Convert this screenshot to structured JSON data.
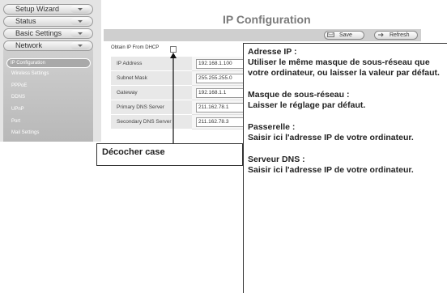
{
  "sidebar": {
    "menu": [
      "Setup Wizard",
      "Status",
      "Basic Settings",
      "Network"
    ],
    "submenu": [
      "IP Configuration",
      "Wireless Settings",
      "PPPoE",
      "DDNS",
      "UPnP",
      "Port",
      "Mail Settings"
    ]
  },
  "header": {
    "title": "IP Configuration",
    "save_label": "Save",
    "refresh_label": "Refresh"
  },
  "form": {
    "dhcp_label": "Obtain IP From DHCP",
    "rows": [
      {
        "label": "IP Address",
        "value": "192.168.1.100"
      },
      {
        "label": "Subnet Mask",
        "value": "255.255.255.0"
      },
      {
        "label": "Gateway",
        "value": "192.168.1.1"
      },
      {
        "label": "Primary DNS Server",
        "value": "211.162.78.1"
      },
      {
        "label": "Secondary DNS Server",
        "value": "211.162.78.3"
      }
    ]
  },
  "annotations": {
    "uncheck": "Décocher case",
    "ip_title": "Adresse IP :",
    "ip_text": "Utiliser le même masque de sous-réseau que votre ordinateur, ou laisser la valeur par défaut.",
    "mask_title": "Masque de sous-réseau :",
    "mask_text": "Laisser le réglage par défaut.",
    "gw_title": "Passerelle :",
    "gw_text": "Saisir ici l'adresse IP de votre ordinateur.",
    "dns_title": "Serveur DNS :",
    "dns_text": "Saisir ici l'adresse IP de votre ordinateur."
  }
}
